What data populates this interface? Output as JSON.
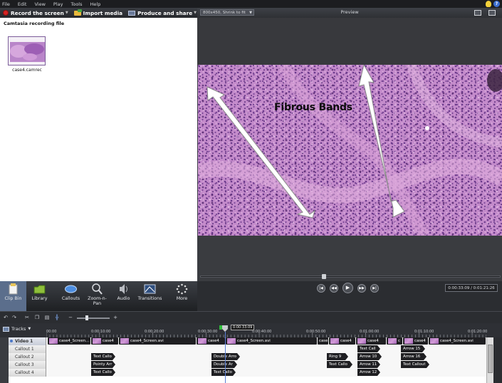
{
  "menu": [
    "File",
    "Edit",
    "View",
    "Play",
    "Tools",
    "Help"
  ],
  "taskbar": {
    "record": "Record the screen",
    "import": "Import media",
    "produce": "Produce and share"
  },
  "clipbin": {
    "header": "Camtasia recording file",
    "clip_name": "case4.camrec"
  },
  "preview": {
    "size_option": "800x450, Shrink to fit",
    "title": "Preview",
    "overlay_text": "Fibrous Bands",
    "timecode": "0:00:33:09 / 0:01:21:26",
    "progress_fraction": 0.41
  },
  "task_tabs": [
    {
      "label": "Clip Bin",
      "icon": "clip-bin-icon",
      "active": true
    },
    {
      "label": "Library",
      "icon": "library-icon",
      "active": false
    },
    {
      "label": "Callouts",
      "icon": "callouts-icon",
      "active": false
    },
    {
      "label": "Zoom-n-\nPan",
      "icon": "zoom-icon",
      "active": false
    },
    {
      "label": "Audio",
      "icon": "audio-icon",
      "active": false
    },
    {
      "label": "Transitions",
      "icon": "transitions-icon",
      "active": false
    },
    {
      "label": "More",
      "icon": "more-icon",
      "active": false
    }
  ],
  "timeline": {
    "tracks_label": "Tracks",
    "playhead": "0:00:33:09",
    "ticks": [
      "00:00",
      "0:00:10:00",
      "0:00:20:00",
      "0:00:30:00",
      "0:00:40:00",
      "0:00:50:00",
      "0:01:00:00",
      "0:01:10:00",
      "0:01:20:00"
    ],
    "tracks": [
      "Video 1",
      "Callout 1",
      "Callout 2",
      "Callout 3",
      "Callout 4"
    ],
    "video_clips": [
      "case4_Screen...",
      "case4",
      "case4_Screen.avi",
      "case4",
      "case4_Screen.avi",
      "case",
      "case4",
      "case4",
      "c",
      "case4",
      "case4_Screen.avi"
    ],
    "callout1": [
      "Text Call",
      "Arrow 15"
    ],
    "callout2": [
      "Text Callo",
      "Double Arro",
      "Ring 9",
      "Arrow 10",
      "Arrow 16"
    ],
    "callout3": [
      "Pointy Arr",
      "Double Ar",
      "Text Callo",
      "Arrow 11",
      "Text Callout"
    ],
    "callout4": [
      "Text Callo",
      "Text Callo",
      "Arrow 12"
    ]
  },
  "colors": {
    "accent": "#5b6e8c",
    "record_red": "#d62424",
    "playhead_blue": "#5a7fd6",
    "tissue_pink": "#c58cc8"
  }
}
